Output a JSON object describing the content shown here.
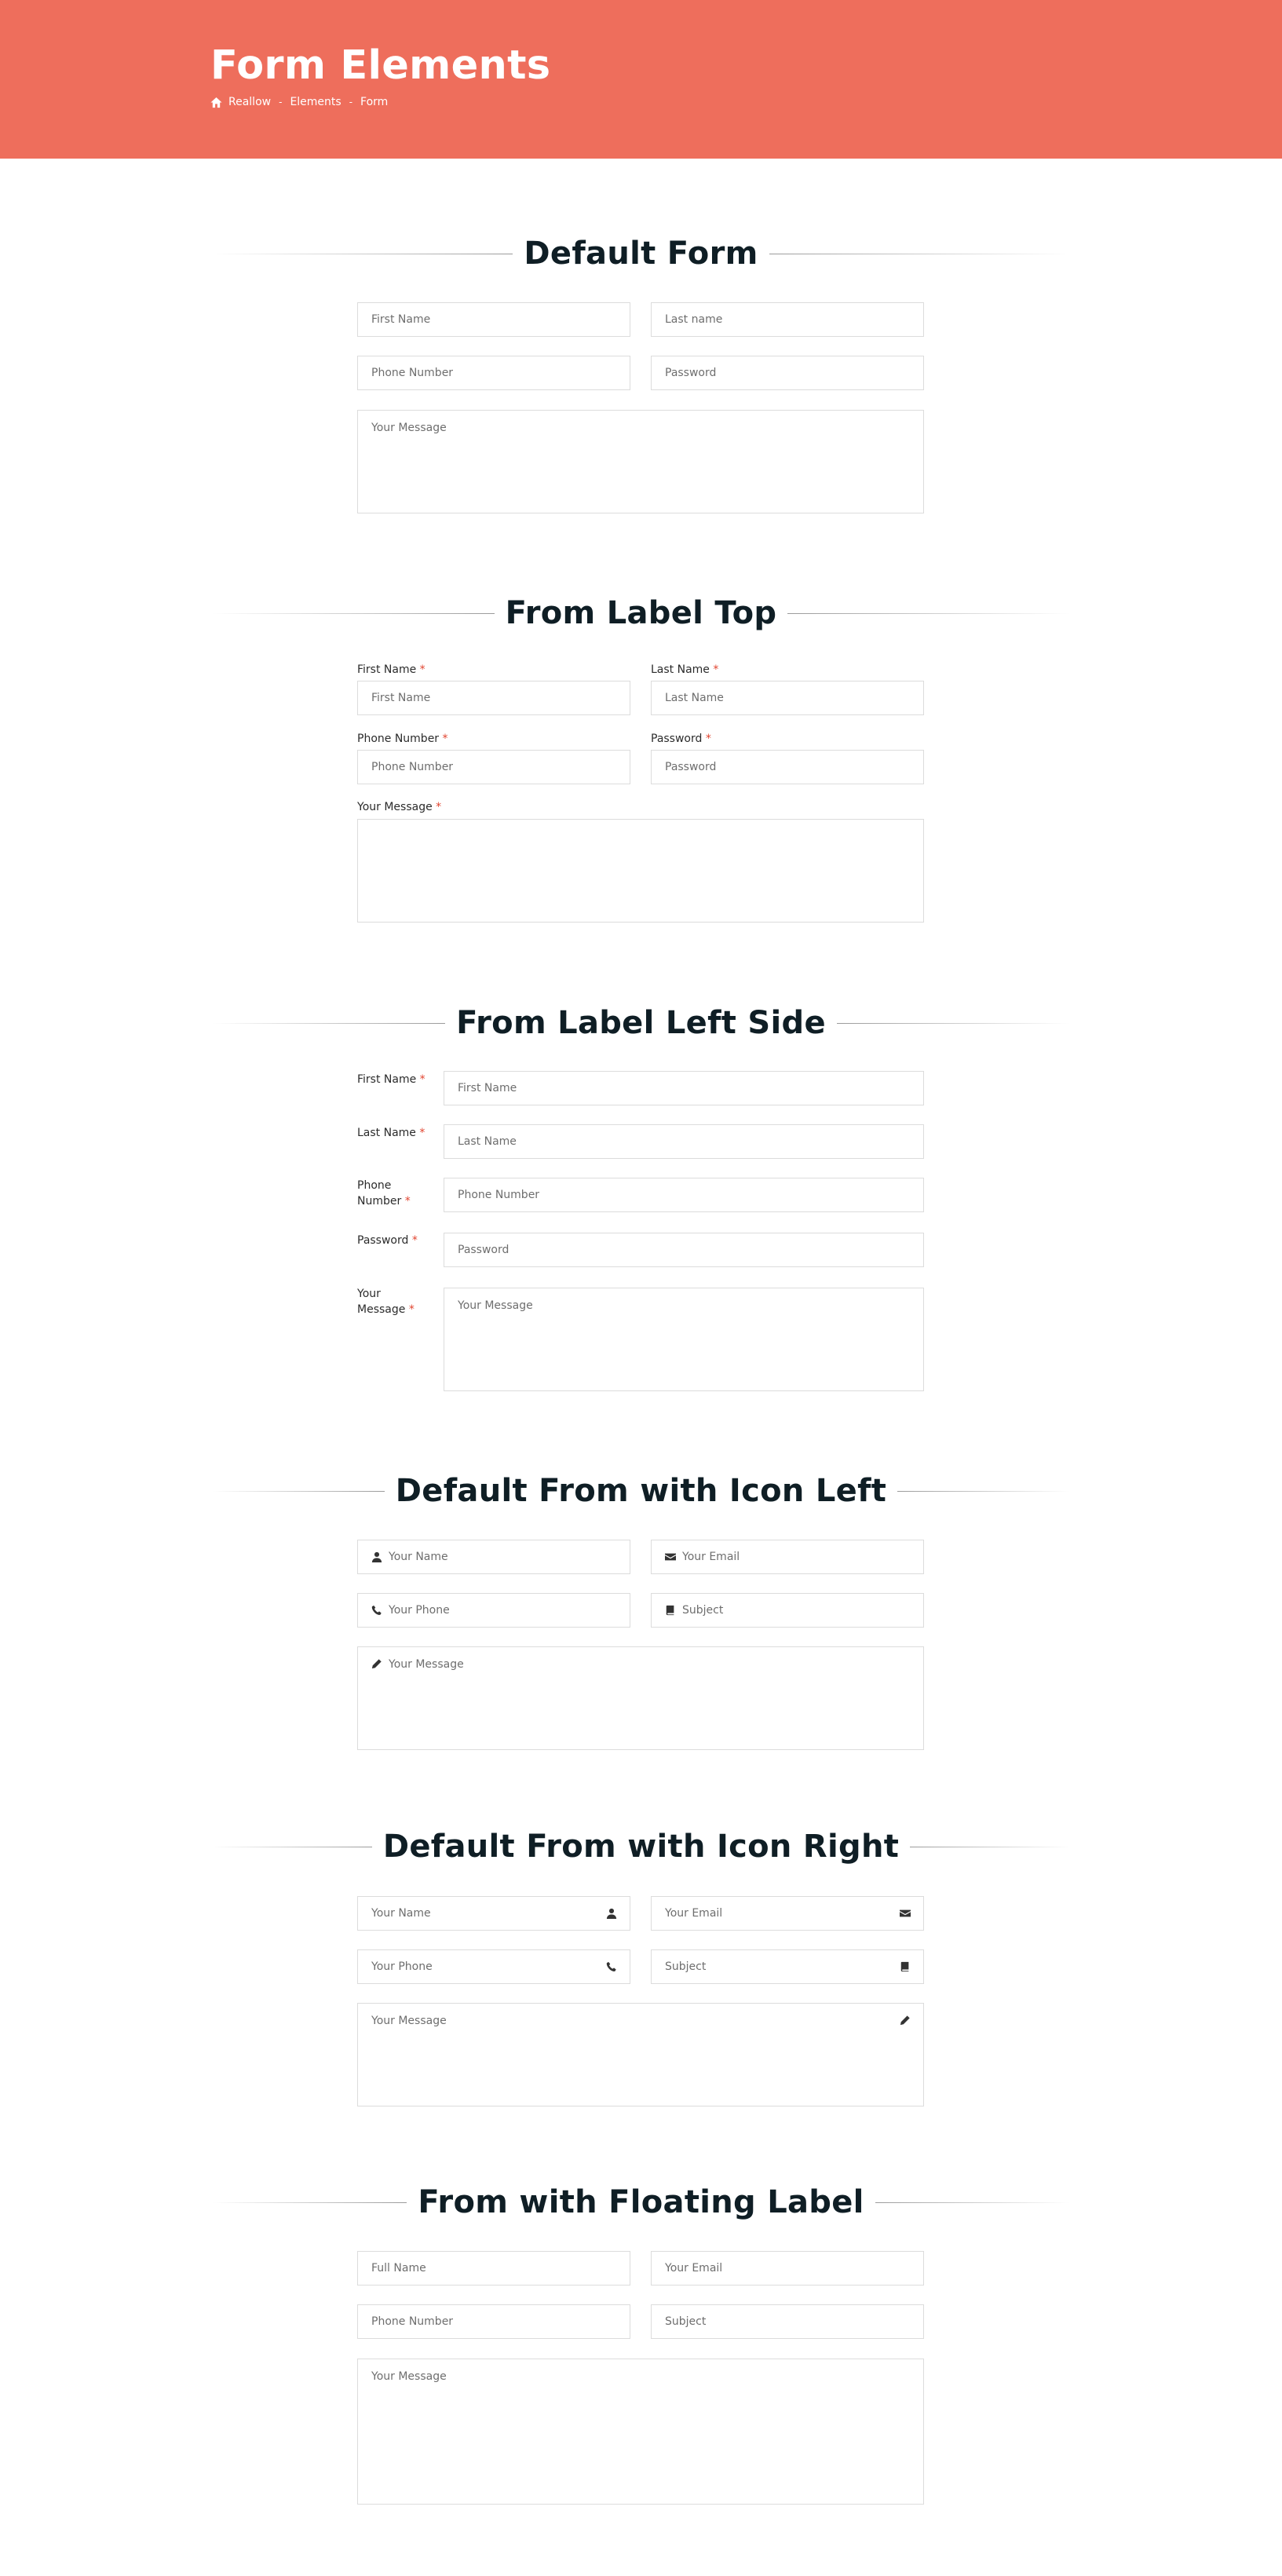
{
  "header": {
    "title": "Form Elements",
    "breadcrumb": [
      "Reallow",
      "Elements",
      "Form"
    ],
    "separator": "-",
    "bg_color": "#ee6e5c"
  },
  "required_mark": "*",
  "sections": {
    "default_form": {
      "title": "Default Form",
      "first_name": "First Name",
      "last_name": "Last name",
      "phone": "Phone Number",
      "password": "Password",
      "message": "Your Message"
    },
    "label_top": {
      "title": "From Label Top",
      "first_name_label": "First Name",
      "first_name": "First Name",
      "last_name_label": "Last Name",
      "last_name": "Last Name",
      "phone_label": "Phone Number",
      "phone": "Phone Number",
      "password_label": "Password",
      "password": "Password",
      "message_label": "Your Message"
    },
    "label_left": {
      "title": "From Label Left Side",
      "first_name_label": "First Name",
      "first_name": "First Name",
      "last_name_label": "Last Name",
      "last_name": "Last Name",
      "phone_label_1": "Phone",
      "phone_label_2": "Number",
      "phone": "Phone Number",
      "password_label": "Password",
      "password": "Password",
      "message_label_1": "Your",
      "message_label_2": "Message",
      "message": "Your Message"
    },
    "icon_left": {
      "title": "Default From with Icon Left",
      "name": "Your Name",
      "email": "Your Email",
      "phone": "Your Phone",
      "subject": "Subject",
      "message": "Your Message"
    },
    "icon_right": {
      "title": "Default From with Icon Right",
      "name": "Your Name",
      "email": "Your Email",
      "phone": "Your Phone",
      "subject": "Subject",
      "message": "Your Message"
    },
    "floating": {
      "title": "From with Floating Label",
      "full_name": "Full Name",
      "email": "Your Email",
      "phone": "Phone Number",
      "subject": "Subject",
      "message": "Your Message"
    }
  },
  "icons": {
    "user": "user-icon",
    "email": "envelope-icon",
    "phone": "phone-icon",
    "subject": "book-icon",
    "message": "pencil-icon",
    "home": "home-icon"
  }
}
